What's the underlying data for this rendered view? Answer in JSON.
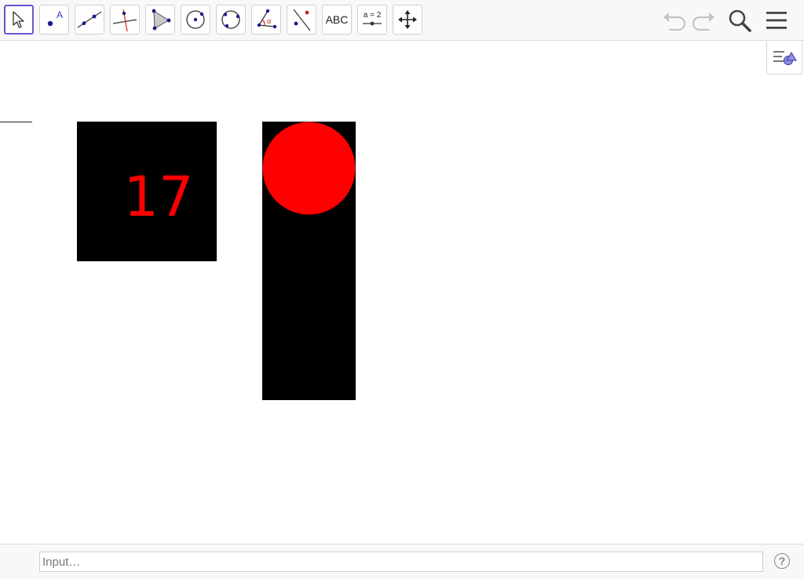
{
  "toolbar": {
    "tools": [
      {
        "name": "move-tool",
        "icon": "cursor-arrow-icon",
        "active": true
      },
      {
        "name": "point-tool",
        "icon": "point-icon",
        "letter": "A"
      },
      {
        "name": "line-tool",
        "icon": "line-through-two-points-icon"
      },
      {
        "name": "perpendicular-line-tool",
        "icon": "perpendicular-line-icon"
      },
      {
        "name": "polygon-tool",
        "icon": "polygon-icon"
      },
      {
        "name": "circle-center-point-tool",
        "icon": "circle-center-point-icon"
      },
      {
        "name": "circle-three-points-tool",
        "icon": "circle-three-points-icon"
      },
      {
        "name": "angle-tool",
        "icon": "angle-icon",
        "letter": "α"
      },
      {
        "name": "reflect-tool",
        "icon": "reflect-about-line-icon"
      },
      {
        "name": "text-tool",
        "icon": "text-icon",
        "label": "ABC"
      },
      {
        "name": "slider-tool",
        "icon": "slider-icon",
        "label": "a = 2"
      },
      {
        "name": "move-graphics-view-tool",
        "icon": "move-arrows-icon"
      }
    ],
    "undo_icon": "undo-icon",
    "redo_icon": "redo-icon",
    "search_icon": "search-icon",
    "menu_icon": "hamburger-menu-icon"
  },
  "graphics": {
    "number_box_text": "17",
    "number_color": "#ff0000",
    "circle_color": "#ff0000",
    "shape_color": "#000000"
  },
  "style_bar_icon": "style-bar-toggle-icon",
  "input_bar": {
    "placeholder": "Input…",
    "value": ""
  },
  "help_label": "?",
  "colors": {
    "accent": "#6557d2",
    "point_blue": "#1a1a8c",
    "line_red": "#cc2222"
  }
}
